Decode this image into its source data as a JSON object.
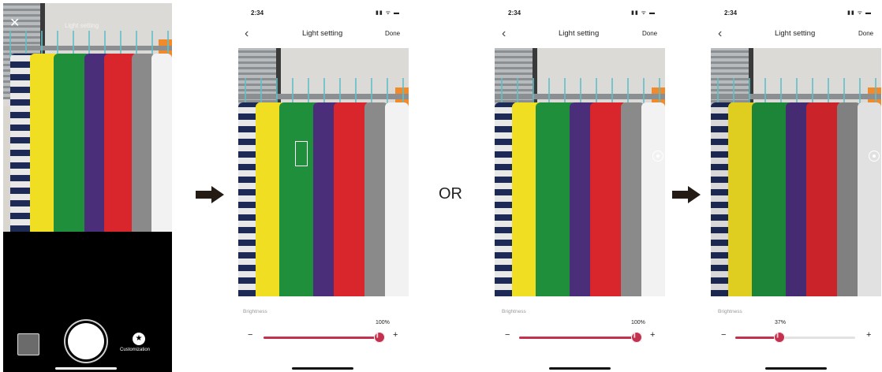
{
  "camera": {
    "title": "Light setting",
    "customization_label": "Customization"
  },
  "screens": [
    {
      "time": "2:34",
      "title": "Light setting",
      "done_label": "Done",
      "brightness_label": "Brightness",
      "brightness_value": "100%",
      "minus": "−",
      "plus": "+"
    },
    {
      "time": "2:34",
      "title": "Light setting",
      "done_label": "Done",
      "brightness_label": "Brightness",
      "brightness_value": "100%",
      "minus": "−",
      "plus": "+"
    },
    {
      "time": "2:34",
      "title": "Light setting",
      "done_label": "Done",
      "brightness_label": "Brightness",
      "brightness_value": "37%",
      "minus": "−",
      "plus": "+"
    }
  ],
  "or_text": "OR",
  "icons": {
    "back": "‹",
    "close": "✕",
    "status": "▮▮ ᯤ ▬",
    "star": "★"
  },
  "colors": {
    "accent": "#c4314f"
  },
  "brightness_fractions": [
    1.0,
    1.0,
    0.37
  ]
}
